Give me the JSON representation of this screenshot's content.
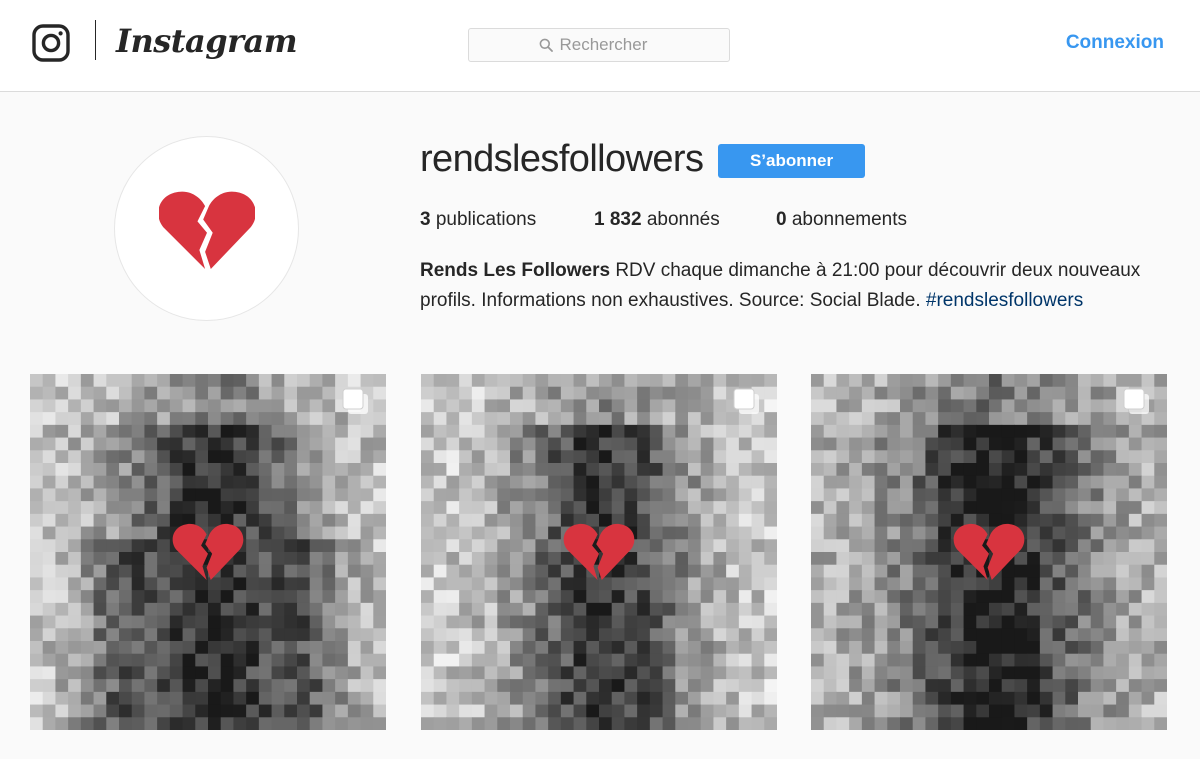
{
  "nav": {
    "brand": "Instagram",
    "search_placeholder": "Rechercher",
    "login_label": "Connexion"
  },
  "profile": {
    "username": "rendslesfollowers",
    "follow_label": "S’abonner",
    "stats": [
      {
        "count": "3",
        "label": "publications"
      },
      {
        "count": "1 832",
        "label": "abonnés"
      },
      {
        "count": "0",
        "label": "abonnements"
      }
    ],
    "bio_name": "Rends Les Followers",
    "bio_text": "RDV chaque dimanche à 21:00 pour découvrir deux nouveaux profils. Informations non exhaustives. Source: Social Blade.",
    "bio_hashtag": "#rendslesfollowers",
    "avatar_icon": "broken-heart-icon"
  },
  "posts": [
    {
      "overlay_icon": "broken-heart-icon",
      "badge_icon": "multiple-photos-icon",
      "style": "pixelated-bw"
    },
    {
      "overlay_icon": "broken-heart-icon",
      "badge_icon": "multiple-photos-icon",
      "style": "pixelated-bw"
    },
    {
      "overlay_icon": "broken-heart-icon",
      "badge_icon": "multiple-photos-icon",
      "style": "pixelated-bw"
    }
  ],
  "colors": {
    "accent": "#3897f0",
    "heart": "#d8343f",
    "hashtag": "#003569",
    "background": "#fafafa"
  }
}
